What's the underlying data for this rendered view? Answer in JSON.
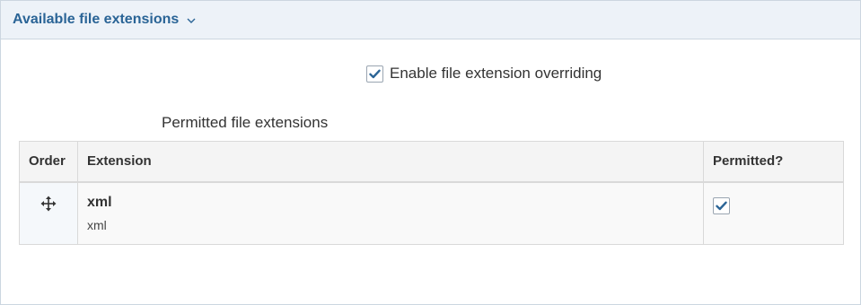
{
  "panel": {
    "title": "Available file extensions",
    "chevron_icon": "chevron-down-icon"
  },
  "override": {
    "label": "Enable file extension overriding",
    "checked": true
  },
  "table": {
    "caption": "Permitted file extensions",
    "headers": {
      "order": "Order",
      "extension": "Extension",
      "permitted": "Permitted?"
    },
    "rows": [
      {
        "drag_icon": "move-handle-icon",
        "label": "xml",
        "machine_name": "xml",
        "permitted": true
      }
    ]
  },
  "colors": {
    "accent": "#2a6496",
    "header_bg": "#edf2f8",
    "checkmark": "#2a6496"
  }
}
